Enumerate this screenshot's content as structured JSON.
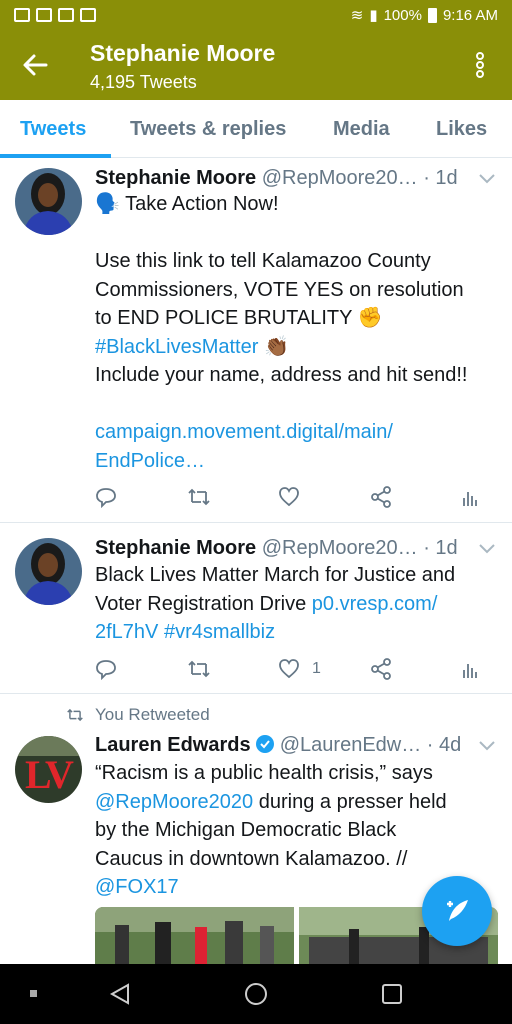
{
  "status_bar": {
    "battery": "100%",
    "time": "9:16 AM"
  },
  "header": {
    "title": "Stephanie Moore",
    "subtitle": "4,195 Tweets"
  },
  "tabs": [
    {
      "label": "Tweets",
      "active": true
    },
    {
      "label": "Tweets & replies",
      "active": false
    },
    {
      "label": "Media",
      "active": false
    },
    {
      "label": "Likes",
      "active": false
    }
  ],
  "tweets": [
    {
      "name": "Stephanie Moore",
      "handle": "@RepMoore20…",
      "time": "· 1d",
      "lines": [
        "🗣️ Take Action Now!",
        "",
        "Use this link to tell Kalamazoo County",
        "Commissioners, VOTE YES on resolution",
        "to END POLICE BRUTALITY ✊",
        "#BlackLivesMatter 👏🏾",
        "Include your name, address and hit send!!",
        "",
        "campaign.movement.digital/main/",
        "EndPolice…"
      ],
      "likes": ""
    },
    {
      "name": "Stephanie Moore",
      "handle": "@RepMoore20…",
      "time": "· 1d",
      "line1": "Black Lives Matter March for Justice and",
      "line2a": "Voter Registration Drive ",
      "line2b": "p0.vresp.com/",
      "line3a": "2fL7hV",
      "line3b": " #vr4smallbiz",
      "likes": "1"
    },
    {
      "retweet_label": "You Retweeted",
      "name": "Lauren Edwards",
      "handle": "@LaurenEdw…",
      "time": "· 4d",
      "line1": "“Racism is a public health crisis,” says",
      "line2a": "@RepMoore2020",
      "line2b": " during a presser held",
      "line3": "by the Michigan Democratic Black",
      "line4": "Caucus in downtown Kalamazoo. //",
      "line5": "@FOX17"
    }
  ],
  "colors": {
    "brand_bar": "#8a8f08",
    "accent": "#1da1f2",
    "link": "#1b95e0",
    "muted": "#657786"
  }
}
